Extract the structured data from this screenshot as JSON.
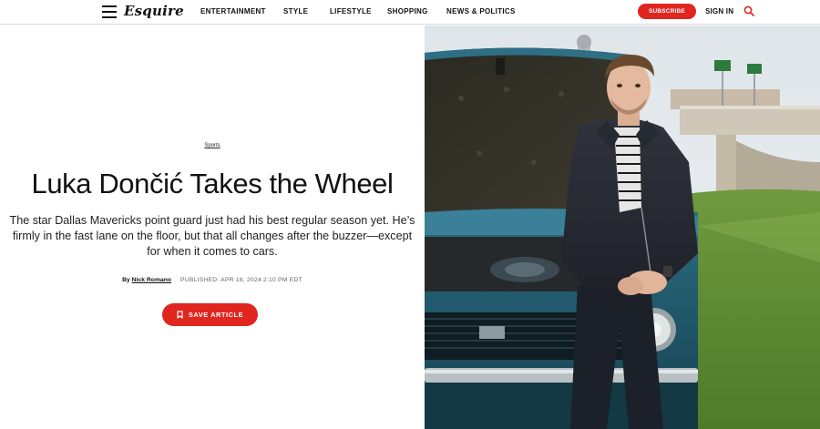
{
  "header": {
    "logo": "Esquire",
    "nav": [
      "ENTERTAINMENT",
      "STYLE",
      "LIFESTYLE",
      "SHOPPING",
      "NEWS & POLITICS"
    ],
    "subscribe_label": "SUBSCRIBE",
    "signin_label": "SIGN IN",
    "menu_icon": "hamburger-menu-icon",
    "search_icon": "search-icon"
  },
  "article": {
    "category": "Sports",
    "title": "Luka Dončić Takes the Wheel",
    "dek": "The star Dallas Mavericks point guard just had his best regular season yet. He’s firmly in the fast lane on the floor, but that all changes after the buzzer—except for when it comes to cars.",
    "byline_prefix": "By",
    "author": "Nick Romano",
    "published": "PUBLISHED: APR 18, 2024 2:10 PM EDT",
    "save_label": "SAVE ARTICLE",
    "save_icon": "bookmark-icon"
  },
  "colors": {
    "accent": "#e0261f",
    "text": "#111111",
    "divider": "#d9d9d9"
  }
}
